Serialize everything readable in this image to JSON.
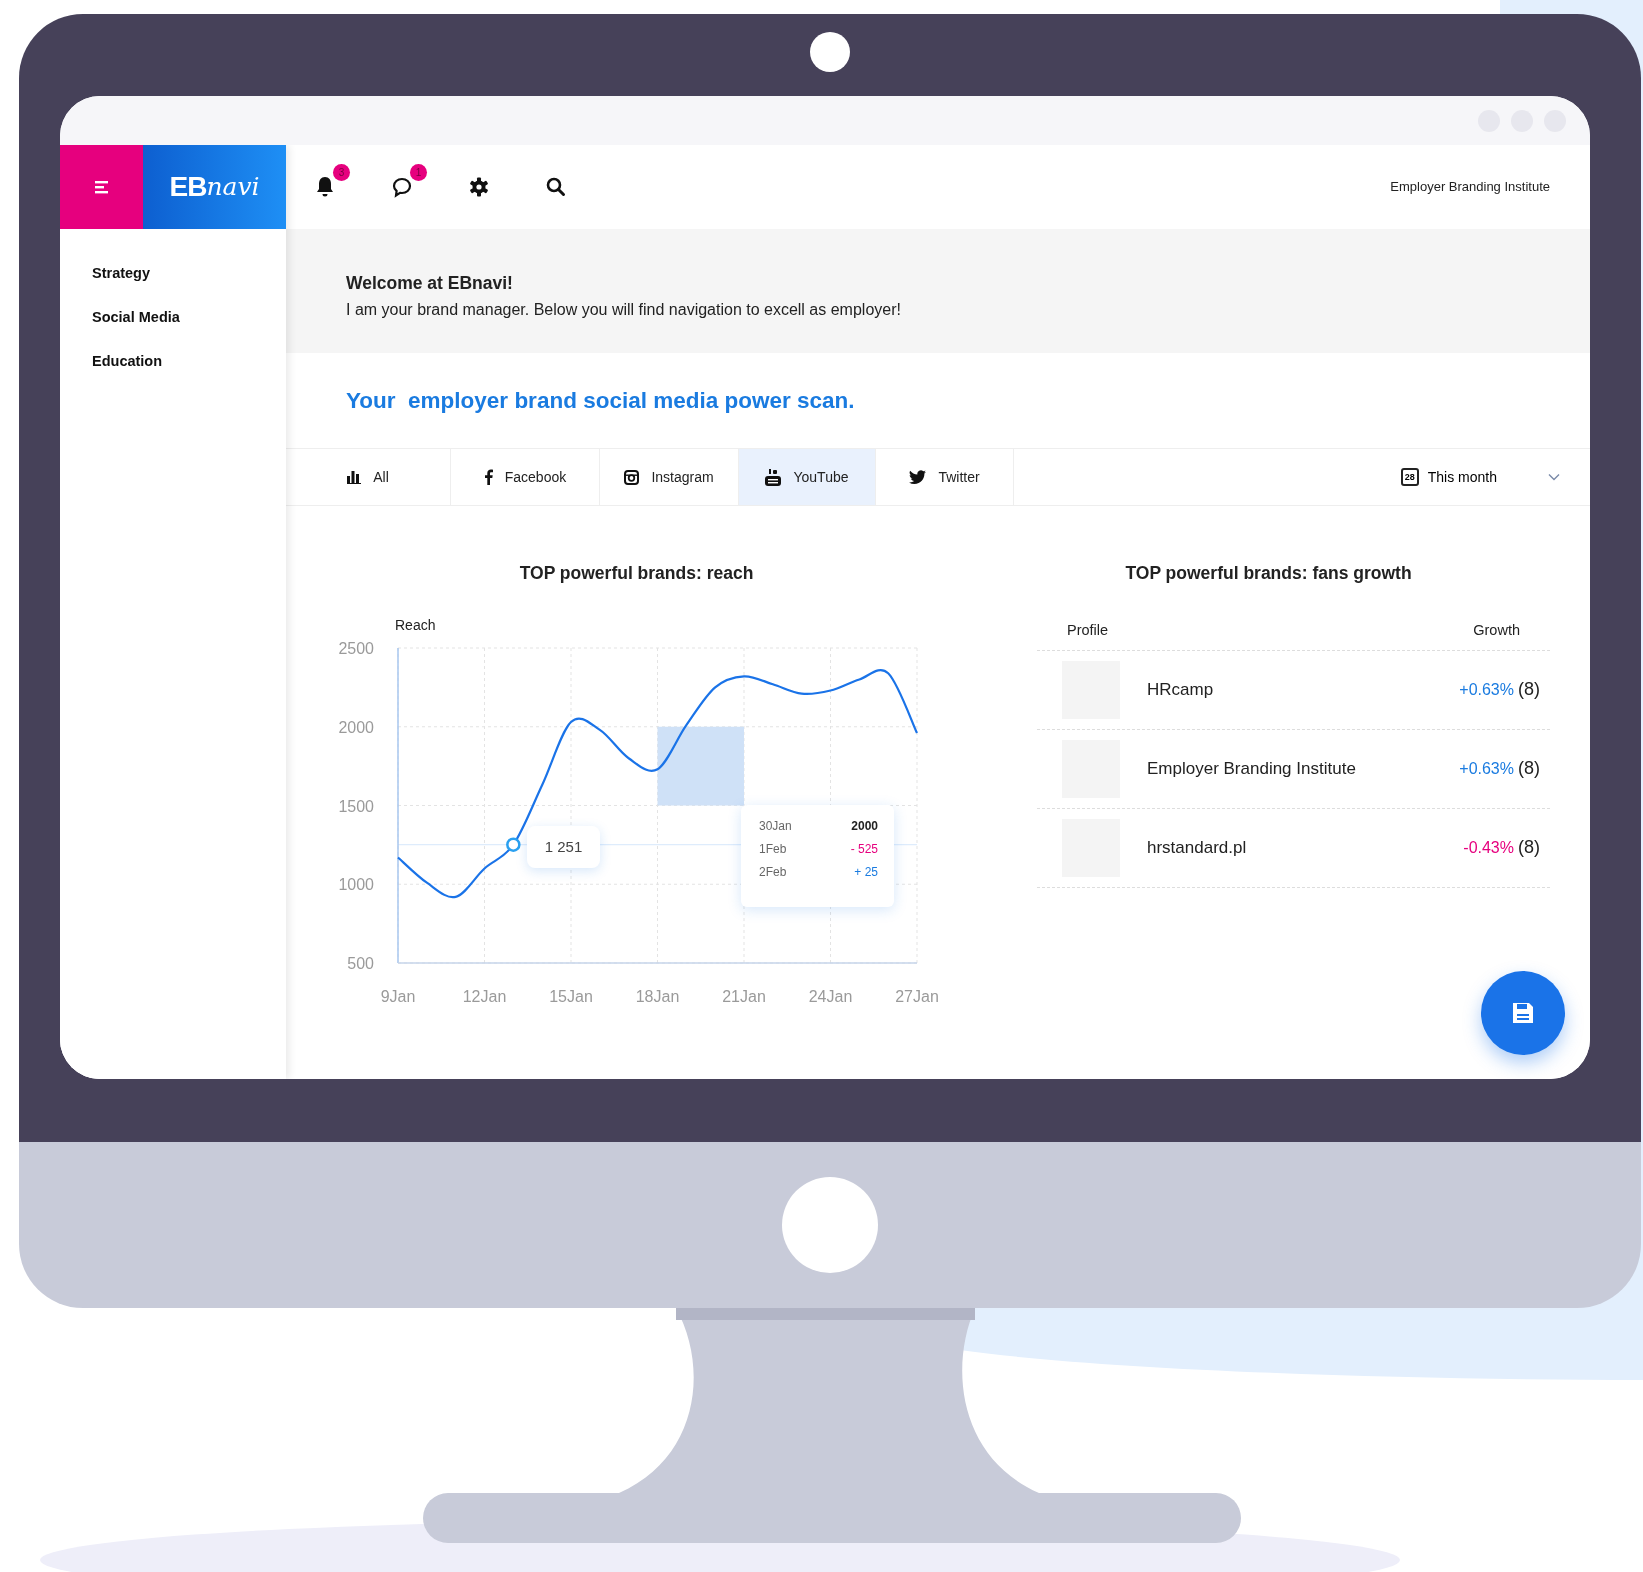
{
  "header": {
    "logo": "**EB**navi",
    "notifications_badge": "3",
    "messages_badge": "1",
    "account": "Employer Branding Institute"
  },
  "sidebar": {
    "items": [
      {
        "label": "Strategy"
      },
      {
        "label": "Social Media"
      },
      {
        "label": "Education"
      }
    ]
  },
  "welcome": {
    "title": "Welcome at EBnavi!",
    "text": "I am your brand manager. Below you will find navigation to excell as employer!"
  },
  "heading": "Your  employer brand social media power scan.",
  "tabs": [
    {
      "label": "All",
      "selected": false
    },
    {
      "label": "Facebook",
      "selected": false
    },
    {
      "label": "Instagram",
      "selected": false
    },
    {
      "label": "YouTube",
      "selected": true
    },
    {
      "label": "Twitter",
      "selected": false
    }
  ],
  "date_filter": {
    "calendar_day": "28",
    "label": "This month"
  },
  "reach_panel": {
    "title": "TOP powerful brands: reach",
    "chart_data": {
      "type": "line",
      "ylabel": "Reach",
      "categories": [
        "9Jan",
        null,
        null,
        "12Jan",
        null,
        null,
        "15Jan",
        null,
        null,
        "18Jan",
        null,
        null,
        "21Jan",
        null,
        null,
        "24Jan",
        null,
        null,
        "27Jan"
      ],
      "values": [
        1170,
        1010,
        920,
        1100,
        1251,
        1630,
        2030,
        1980,
        1800,
        1730,
        2010,
        2250,
        2320,
        2270,
        2210,
        2230,
        2300,
        2340,
        1960
      ],
      "yticks": [
        500,
        1000,
        1500,
        2000,
        2500
      ],
      "ylim": [
        500,
        2500
      ],
      "grid": true,
      "ref_lines": [
        {
          "axis": "y",
          "value": 1251
        }
      ]
    },
    "point_label": "1 251",
    "tooltip": [
      {
        "date": "30Jan",
        "value": "2000",
        "kind": "neutral"
      },
      {
        "date": "1Feb",
        "value": "- 525",
        "kind": "negative"
      },
      {
        "date": "2Feb",
        "value": "+ 25",
        "kind": "positive"
      }
    ]
  },
  "growth_panel": {
    "title": "TOP powerful brands: fans growth",
    "columns": [
      "Profile",
      "Growth"
    ],
    "rows": [
      {
        "name": "HRcamp",
        "growth": "+0.63%",
        "count": "(8)",
        "color": "#1a7be0"
      },
      {
        "name": "Employer Branding Institute",
        "growth": "+0.63%",
        "count": "(8)",
        "color": "#1a7be0"
      },
      {
        "name": "hrstandard.pl",
        "growth": "-0.43%",
        "count": "(8)",
        "color": "#e6007e"
      }
    ]
  }
}
